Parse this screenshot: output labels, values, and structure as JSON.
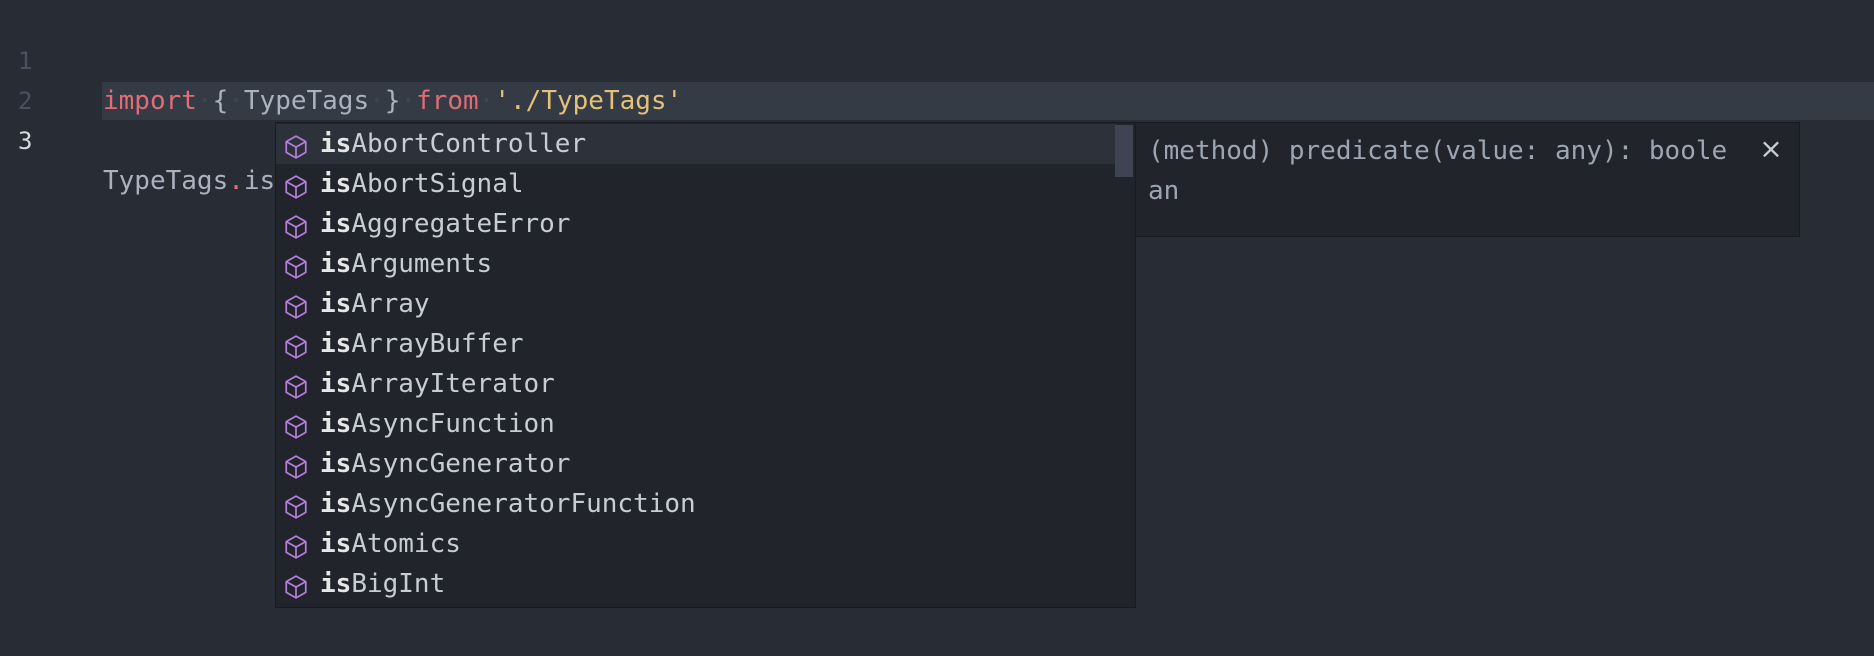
{
  "editor": {
    "lines": [
      {
        "number": "1",
        "tokens": {
          "import": "import",
          "lbrace": "{",
          "name": "TypeTags",
          "rbrace": "}",
          "from": "from",
          "source": "'./TypeTags'"
        }
      },
      {
        "number": "2"
      },
      {
        "number": "3",
        "tokens": {
          "object": "TypeTags",
          "dot": ".",
          "member": "is"
        }
      }
    ],
    "whitespace_glyph": "·"
  },
  "suggest": {
    "match_prefix": "is",
    "items": [
      {
        "match": "is",
        "rest": "AbortController",
        "icon": "cube-icon"
      },
      {
        "match": "is",
        "rest": "AbortSignal",
        "icon": "cube-icon"
      },
      {
        "match": "is",
        "rest": "AggregateError",
        "icon": "cube-icon"
      },
      {
        "match": "is",
        "rest": "Arguments",
        "icon": "cube-icon"
      },
      {
        "match": "is",
        "rest": "Array",
        "icon": "cube-icon"
      },
      {
        "match": "is",
        "rest": "ArrayBuffer",
        "icon": "cube-icon"
      },
      {
        "match": "is",
        "rest": "ArrayIterator",
        "icon": "cube-icon"
      },
      {
        "match": "is",
        "rest": "AsyncFunction",
        "icon": "cube-icon"
      },
      {
        "match": "is",
        "rest": "AsyncGenerator",
        "icon": "cube-icon"
      },
      {
        "match": "is",
        "rest": "AsyncGeneratorFunction",
        "icon": "cube-icon"
      },
      {
        "match": "is",
        "rest": "Atomics",
        "icon": "cube-icon"
      },
      {
        "match": "is",
        "rest": "BigInt",
        "icon": "cube-icon"
      }
    ],
    "selected_index": 0
  },
  "details": {
    "signature": "(method) predicate(value: any): boolean",
    "close_glyph": "×"
  },
  "colors": {
    "background": "#282c34",
    "keyword": "#e06c75",
    "string": "#e5c07b",
    "text": "#abb2bf",
    "icon_purple": "#b57edc",
    "widget_bg": "#21252b"
  }
}
